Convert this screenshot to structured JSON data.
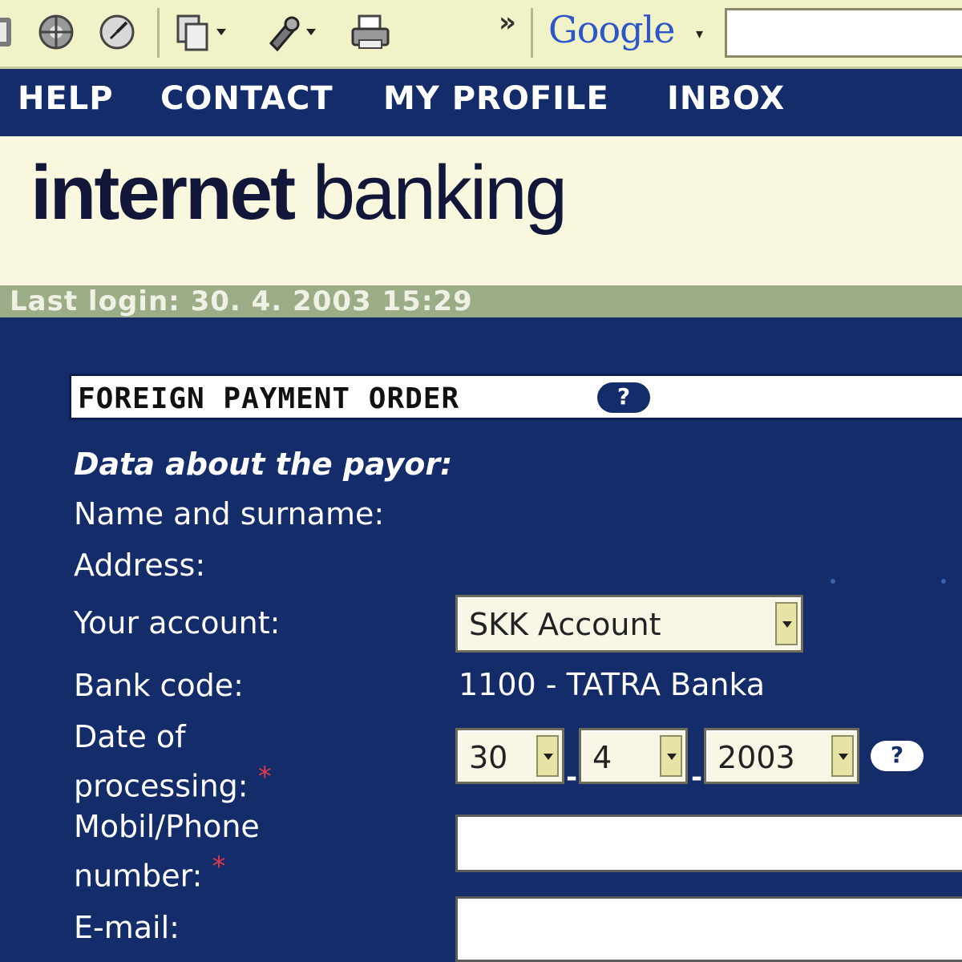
{
  "browser": {
    "toolbar_overflow": "»",
    "search_engine_label": "Google",
    "search_dropdown": "▾",
    "search_value": ""
  },
  "nav": {
    "items": [
      {
        "label": "HELP"
      },
      {
        "label": "CONTACT"
      },
      {
        "label": "MY PROFILE"
      },
      {
        "label": "INBOX"
      }
    ]
  },
  "banner": {
    "logo_bold": "internet",
    "logo_light": "banking"
  },
  "session": {
    "last_login": "Last login: 30. 4. 2003 15:29"
  },
  "form": {
    "title": "FOREIGN PAYMENT ORDER",
    "help_icon_text": "?",
    "payor_heading": "Data about the payor:",
    "name_label": "Name and surname:",
    "address_label": "Address:",
    "account_label": "Your account:",
    "account_value": "SKK Account",
    "bank_code_label": "Bank code:",
    "bank_code_value": "1100 - TATRA Banka",
    "date_label_line1": "Date of",
    "date_label_line2": "processing:",
    "required_mark": "*",
    "date_day": "30",
    "date_month": "4",
    "date_year": "2003",
    "date_separator": "-",
    "phone_label_line1": "Mobil/Phone",
    "phone_label_line2": "number:",
    "phone_value": "",
    "email_label": "E-mail:",
    "email_value": ""
  },
  "colors": {
    "navy": "#152c6b",
    "cream": "#f9f8de",
    "sage": "#9cac86",
    "required": "#d83a4a"
  }
}
